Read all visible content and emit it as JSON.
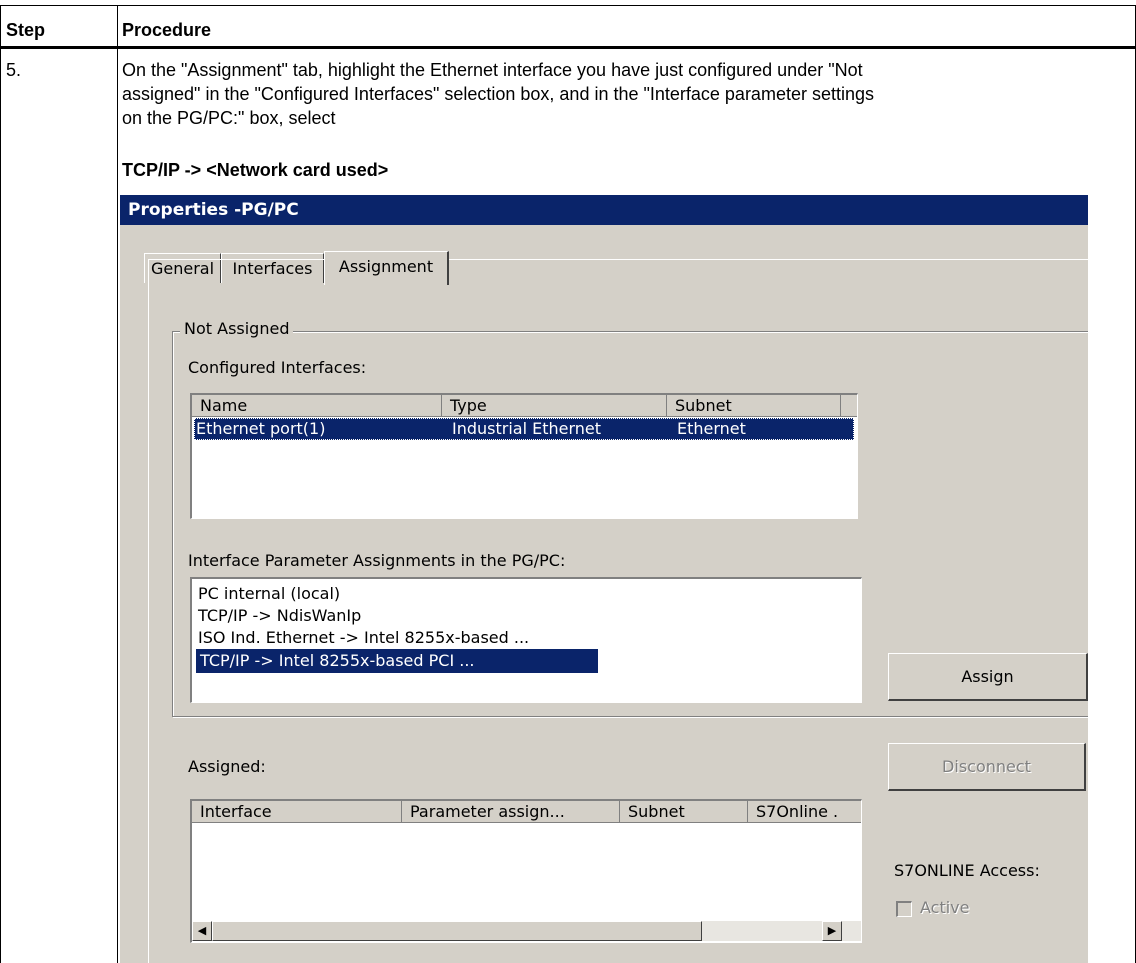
{
  "table": {
    "header_step": "Step",
    "header_procedure": "Procedure",
    "step_number": "5.",
    "instruction_lines": [
      "On the \"Assignment\" tab, highlight the Ethernet interface you have just configured under \"Not",
      "assigned\" in the \"Configured Interfaces\" selection box, and in the \"Interface parameter settings",
      "on the PG/PC:\" box, select"
    ],
    "selection_path": "TCP/IP -> <Network card used>"
  },
  "dialog": {
    "title": "Properties -PG/PC",
    "tabs": [
      "General",
      "Interfaces",
      "Assignment"
    ],
    "active_tab": "Assignment",
    "not_assigned_group": "Not Assigned",
    "configured_label": "Configured Interfaces:",
    "configured_columns": [
      "Name",
      "Type",
      "Subnet"
    ],
    "configured_rows": [
      {
        "name": "Ethernet port(1)",
        "type": "Industrial Ethernet",
        "subnet": "Ethernet"
      }
    ],
    "param_label": "Interface Parameter Assignments in the PG/PC:",
    "param_items": [
      "PC internal (local)",
      "TCP/IP -> NdisWanIp",
      "ISO Ind. Ethernet -> Intel 8255x-based ...",
      "TCP/IP -> Intel 8255x-based PCI ..."
    ],
    "assign_button": "Assign",
    "disconnect_button": "Disconnect",
    "assigned_label": "Assigned:",
    "assigned_columns": [
      "Interface",
      "Parameter assign...",
      "Subnet",
      "S7Online ."
    ],
    "s7online_label": "S7ONLINE Access:",
    "active_checkbox_label": "Active"
  }
}
